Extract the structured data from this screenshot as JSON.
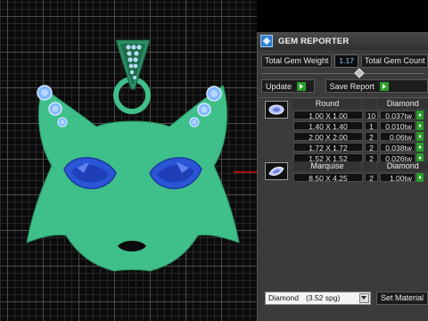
{
  "panel": {
    "title": "GEM REPORTER",
    "total_weight_label": "Total Gem Weight",
    "total_weight_value": "1.17",
    "total_count_label": "Total Gem Count",
    "update_label": "Update",
    "save_report_label": "Save Report",
    "groups": [
      {
        "shape": "Round",
        "material": "Diamond",
        "thumb_icon": "round-gem-icon",
        "rows": [
          {
            "size": "1.00 X 1.00",
            "count": "10",
            "tw": "0.037tw"
          },
          {
            "size": "1.40 X 1.40",
            "count": "1",
            "tw": "0.010tw"
          },
          {
            "size": "2.00 X 2.00",
            "count": "2",
            "tw": "0.06tw"
          },
          {
            "size": "1.72 X 1.72",
            "count": "2",
            "tw": "0.038tw"
          },
          {
            "size": "1.52 X 1.52",
            "count": "2",
            "tw": "0.026tw"
          }
        ]
      },
      {
        "shape": "Marquise",
        "material": "Diamond",
        "thumb_icon": "marquise-gem-icon",
        "rows": [
          {
            "size": "8.50 X 4.25",
            "count": "2",
            "tw": "1.00tw"
          }
        ]
      }
    ],
    "material_select": {
      "name": "Diamond",
      "spg": "(3.52 spg)"
    },
    "set_material_label": "Set Material"
  },
  "viewport": {
    "colors": {
      "pendant": "#3fbf89",
      "pendant_outline": "#2a8f66",
      "eye_gem": "#2a55d6",
      "eye_gem_light": "#6f93ff",
      "accent_line": "#e01010"
    }
  }
}
